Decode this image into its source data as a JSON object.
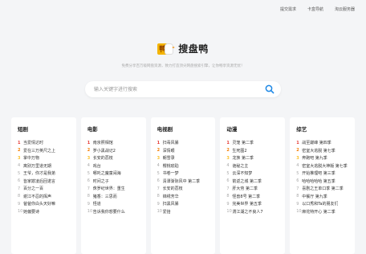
{
  "topnav": {
    "submit": "提交需求",
    "card_nav": "卡盒导航",
    "cloud": "淘云服务器"
  },
  "logo": {
    "badge_char": "鸭",
    "name": "搜盘鸭"
  },
  "tagline": "免费分享百万级网盘资源，致力打造顶尖网盘搜索引擎，让你畅享资源无忧！",
  "search": {
    "placeholder": "输入关键字进行搜索"
  },
  "colors": {
    "rank1": "#e53935",
    "rank2": "#f57c00",
    "rank3": "#fbc02d",
    "accent": "#1e88e5"
  },
  "categories": [
    {
      "title": "短剧",
      "items": [
        "当爱情达时",
        "爱在三万英尺之上",
        "掌中万物",
        "离别万里道无期",
        "王爷，你才是我弟",
        "皆家欺凌后回诺言",
        "百分之一百",
        "谢江不忍的挥声",
        "爸爸你白头天好嘛",
        "她偏要诗"
      ]
    },
    {
      "title": "电影",
      "items": [
        "南京照相馆",
        "罗小黑战记2",
        "长安的荔枝",
        "戏台",
        "哪吒之魔童闹海",
        "时间之子",
        "侏罗纪世界：重生",
        "猪香：三思而",
        "怪道",
        "告诉我你想要什么"
      ]
    },
    {
      "title": "电视剧",
      "items": [
        "扫毒风暴",
        "深情眼",
        "朝雪录",
        "樱桃琥珀",
        "书卷一梦",
        "清潭渐际风中 第二季",
        "长安的荔枝",
        "锦绣芳华",
        "扫黑风暴",
        "爱拾"
      ]
    },
    {
      "title": "动漫",
      "items": [
        "灵笼 第二季",
        "生死图2",
        "龙族 第二季",
        "诡秘之主",
        "云深不知梦",
        "箭返之城 第二季",
        "肝大劳 第二季",
        "怪兽8号 第二季",
        "完美世界 第五季",
        "渭江湖之不良人7"
      ]
    },
    {
      "title": "综艺",
      "items": [
        "战至巅峰 第四季",
        "密室大逃脱 第七季",
        "奔跑吧 第九季",
        "密室大逃脱大神版 第七季",
        "开始推理吧 第三季",
        "哈哈哈哈哈 第五季",
        "喜剧之王单口季 第二季",
        "中餐厅 第九季",
        "以口秀和Ta的朋友们",
        "麻花特开心 第二季"
      ]
    }
  ]
}
